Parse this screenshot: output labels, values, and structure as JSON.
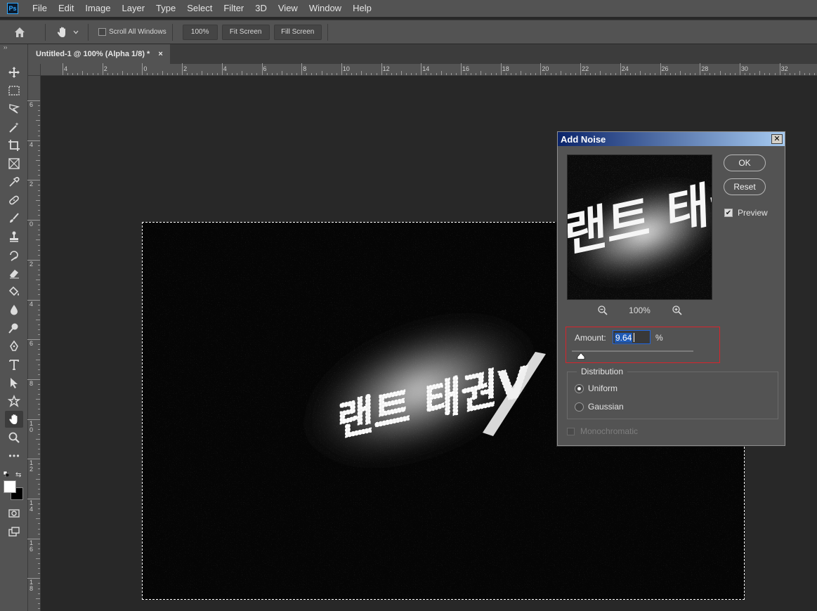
{
  "app": {
    "logo_text": "Ps"
  },
  "menu": [
    "File",
    "Edit",
    "Image",
    "Layer",
    "Type",
    "Select",
    "Filter",
    "3D",
    "View",
    "Window",
    "Help"
  ],
  "options": {
    "scroll_all_windows": "Scroll All Windows",
    "zoom_btn": "100%",
    "fit_screen": "Fit Screen",
    "fill_screen": "Fill Screen"
  },
  "document": {
    "tab_title": "Untitled-1 @ 100% (Alpha 1/8) *",
    "close": "×"
  },
  "toolbar": {
    "expand": "››",
    "swap": "⇆"
  },
  "ruler": {
    "h_labels": [
      "4",
      "2",
      "0",
      "2",
      "4",
      "6",
      "8",
      "10",
      "12",
      "14",
      "16",
      "18",
      "20",
      "22",
      "24",
      "26",
      "28",
      "30",
      "32"
    ],
    "v_labels": [
      "6",
      "4",
      "2",
      "0",
      "2",
      "4",
      "6",
      "8",
      "1 0",
      "1 2",
      "1 4",
      "1 6",
      "1 8"
    ]
  },
  "canvas_text": "랜트 태권V",
  "dialog": {
    "title": "Add Noise",
    "close": "✕",
    "ok": "OK",
    "reset": "Reset",
    "preview_label": "Preview",
    "preview_checked": true,
    "preview_checkmark": "✔",
    "zoom": "100%",
    "amount_label": "Amount:",
    "amount_value": "9.64",
    "amount_unit": "%",
    "amount_slider_fraction": 0.0241,
    "distribution_label": "Distribution",
    "uniform": "Uniform",
    "gaussian": "Gaussian",
    "selected_distribution": "Uniform",
    "monochromatic": "Monochromatic",
    "monochromatic_enabled": false
  },
  "colors": {
    "accent_blue": "#31a8ff",
    "highlight_red": "#d8242c",
    "panel": "#535353",
    "workspace": "#282828"
  }
}
